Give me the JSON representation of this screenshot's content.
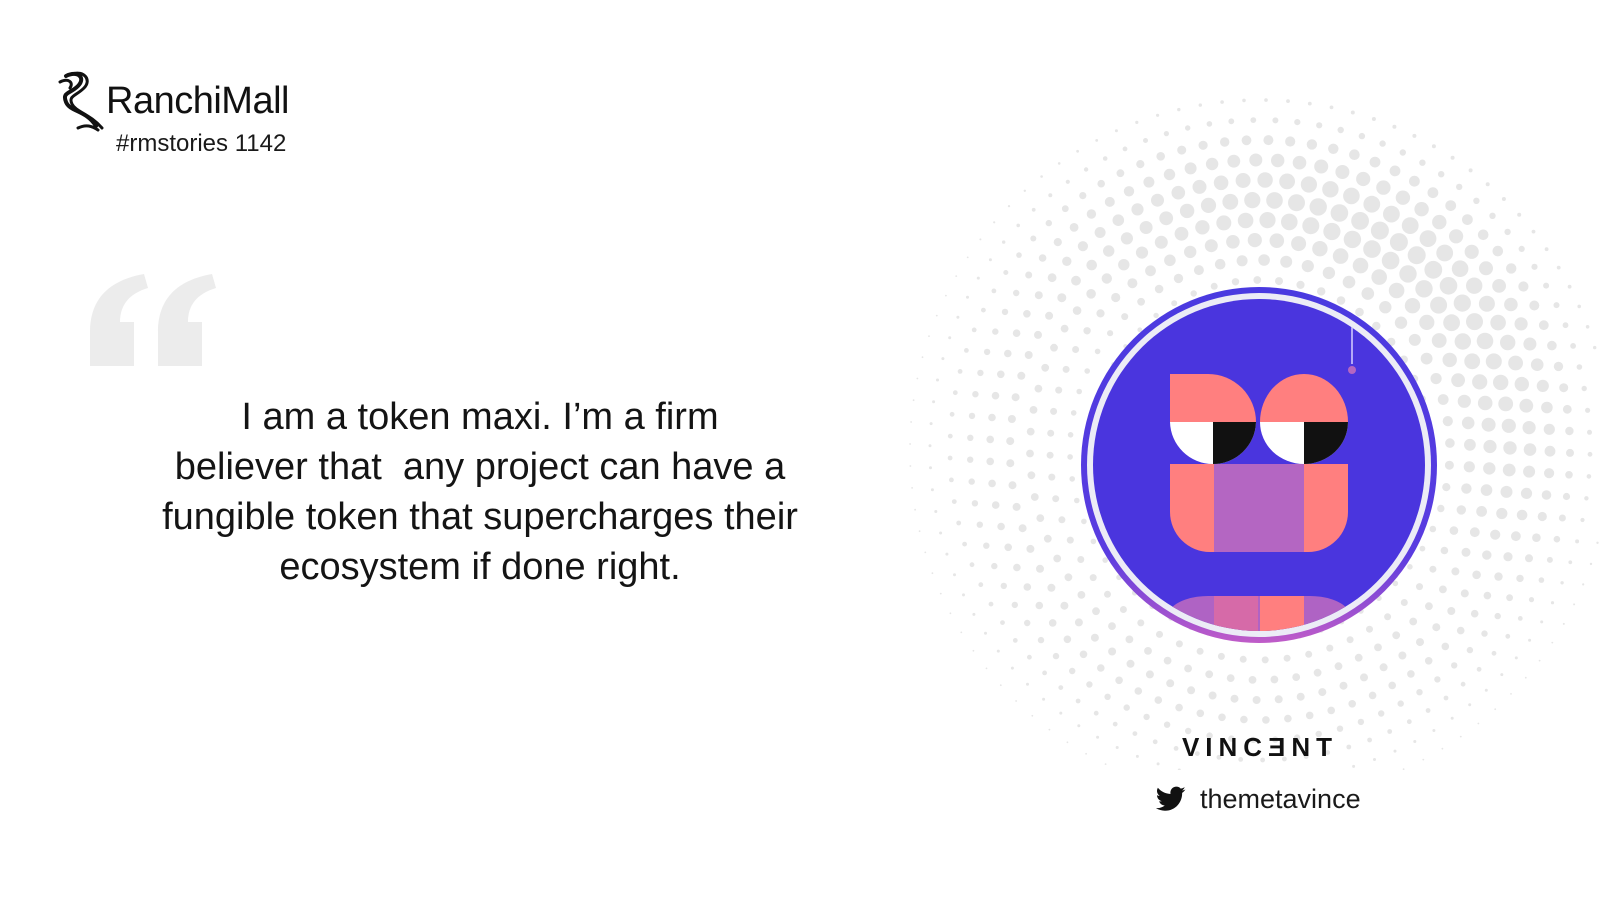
{
  "brand": {
    "name": "RanchiMall",
    "story_tag": "#rmstories 1142",
    "logo_icon": "ranchimall-logo-icon"
  },
  "quote": {
    "icon": "quote-mark-icon",
    "lines": [
      "I am a token maxi. I’m a firm",
      "believer that  any project can have a",
      "fungible token that supercharges their",
      "ecosystem if done right."
    ]
  },
  "person": {
    "name": "VINCƎNT",
    "avatar_icon": "avatar-illustration",
    "social_icon": "twitter-icon",
    "handle": "themetavince"
  },
  "colors": {
    "avatar_ring": "#4a3ae0",
    "avatar_bg": "#4a35de",
    "face_pink": "#ff7f7f",
    "face_mauve": "#b466c2",
    "dots": "#e6e6e6",
    "quote_mark": "#ececec"
  }
}
